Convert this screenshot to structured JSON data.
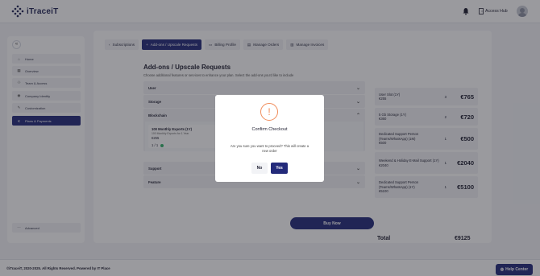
{
  "header": {
    "brand": "iTraceiT",
    "access_hub": "Access Hub"
  },
  "sidebar": {
    "collapse_icon": "«",
    "items": [
      {
        "label": "Home",
        "icon": "home-icon"
      },
      {
        "label": "Overview",
        "icon": "grid-icon"
      },
      {
        "label": "Team & Access",
        "icon": "team-icon"
      },
      {
        "label": "Company Identity",
        "icon": "identity-icon"
      },
      {
        "label": "Customization",
        "icon": "brush-icon"
      },
      {
        "label": "Plans & Payments",
        "icon": "card-icon"
      }
    ],
    "advanced": "Advanced"
  },
  "tabs": [
    {
      "label": "Subscriptions"
    },
    {
      "label": "Add-ons / Upscale Requests"
    },
    {
      "label": "Billing Profile"
    },
    {
      "label": "Manage Orders"
    },
    {
      "label": "Manage Invoices"
    }
  ],
  "page": {
    "title": "Add-ons / Upscale Requests",
    "subtitle": "Choose additional features or services to enhance your plan. Select the add-ons you'd like to include"
  },
  "sections": {
    "user": "User",
    "storage": "Storage",
    "blockchain": "Blockchain",
    "support": "Support",
    "feature": "Feature"
  },
  "addon_card": {
    "name": "100 Monthly Exports (1Y)",
    "sub": "100 Monthly Exports for 1 Year",
    "price": "€255",
    "qty": "1 / 1"
  },
  "summary": {
    "items": [
      {
        "name": "User Slot (1Y)",
        "price": "€255",
        "mult": "3",
        "amount": "€765"
      },
      {
        "name": "5 Gb Storage (1Y)",
        "price": "€360",
        "mult": "2",
        "amount": "€720"
      },
      {
        "name": "Dedicated Support Person (Teams/WhatsApp) (1M)",
        "price": "€500",
        "mult": "1",
        "amount": "€500"
      },
      {
        "name": "Weekend & Holiday E-Mail Support (1Y)",
        "price": "€2040",
        "mult": "1",
        "amount": "€2040"
      },
      {
        "name": "Dedicated Support Person (Teams/WhatsApp) (1Y)",
        "price": "€5100",
        "mult": "1",
        "amount": "€5100"
      }
    ],
    "total_label": "Total",
    "total_value": "€9125",
    "buy_now": "Buy Now"
  },
  "footer": {
    "copyright": "©iTraceiT, 2020-2025. All Rights Reserved. Powered by IT Place",
    "help": "Help Center"
  },
  "modal": {
    "icon": "!",
    "title": "Confirm Checkout",
    "text": "Are you sure you want to proceed? This will create a new order",
    "no": "No",
    "yes": "Yes"
  }
}
